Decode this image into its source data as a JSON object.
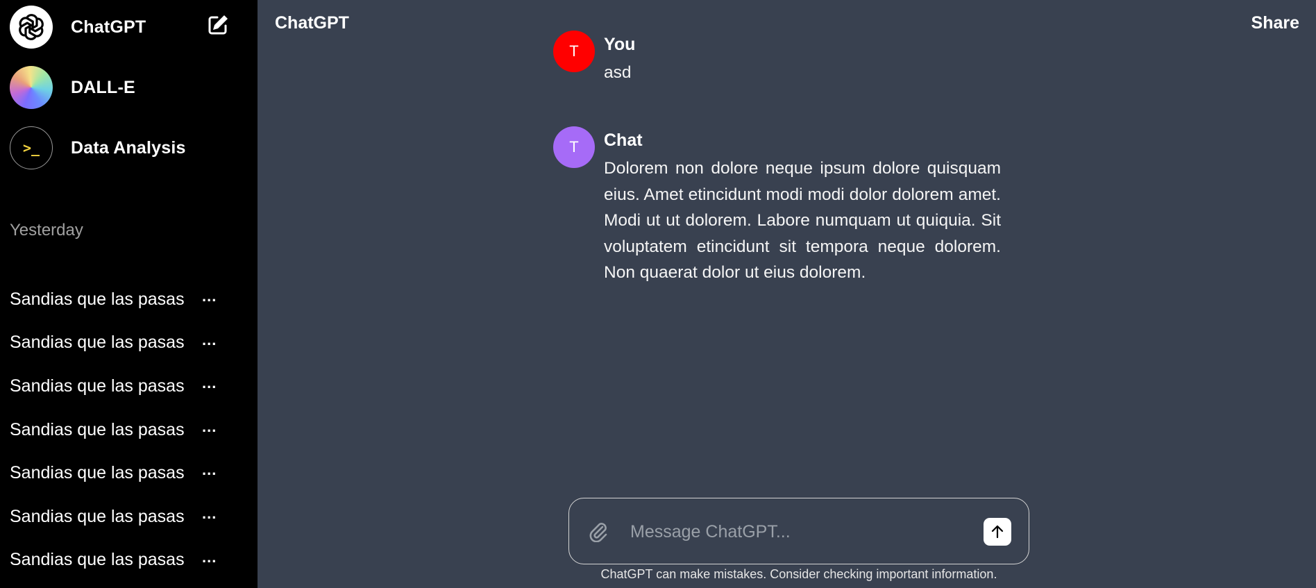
{
  "sidebar": {
    "gpts": [
      {
        "label": "ChatGPT",
        "icon": "openai-logo-icon"
      },
      {
        "label": "DALL-E",
        "icon": "dalle-icon"
      },
      {
        "label": "Data Analysis",
        "icon": "terminal-icon",
        "glyph": ">_"
      }
    ],
    "edit_icon": "new-chat-icon",
    "section_label": "Yesterday",
    "history": [
      {
        "label": "Sandias que las pasas",
        "more": "..."
      },
      {
        "label": "Sandias que las pasas",
        "more": "..."
      },
      {
        "label": "Sandias que las pasas",
        "more": "..."
      },
      {
        "label": "Sandias que las pasas",
        "more": "..."
      },
      {
        "label": "Sandias que las pasas",
        "more": "..."
      },
      {
        "label": "Sandias que las pasas",
        "more": "..."
      },
      {
        "label": "Sandias que las pasas",
        "more": "..."
      }
    ]
  },
  "header": {
    "title": "ChatGPT",
    "share_label": "Share"
  },
  "messages": [
    {
      "author": "You",
      "initial": "T",
      "avatar_color": "#ff0000",
      "text": "asd"
    },
    {
      "author": "Chat",
      "initial": "T",
      "avatar_color": "#a66bf7",
      "text": "Dolorem non dolore neque ipsum dolore quisquam eius. Amet etincidunt modi modi dolor dolorem amet. Modi ut ut dolorem. Labore numquam ut quiquia. Sit voluptatem etincidunt sit tempora neque dolorem. Non quaerat dolor ut eius dolorem."
    }
  ],
  "composer": {
    "placeholder": "Message ChatGPT...",
    "attach_icon": "paperclip-icon",
    "send_icon": "arrow-up-icon"
  },
  "disclaimer": "ChatGPT can make mistakes. Consider checking important information.",
  "colors": {
    "sidebar_bg": "#000000",
    "main_bg": "#394150",
    "user_avatar": "#ff0000",
    "bot_avatar": "#a66bf7",
    "terminal_glyph": "#f1d23f"
  }
}
